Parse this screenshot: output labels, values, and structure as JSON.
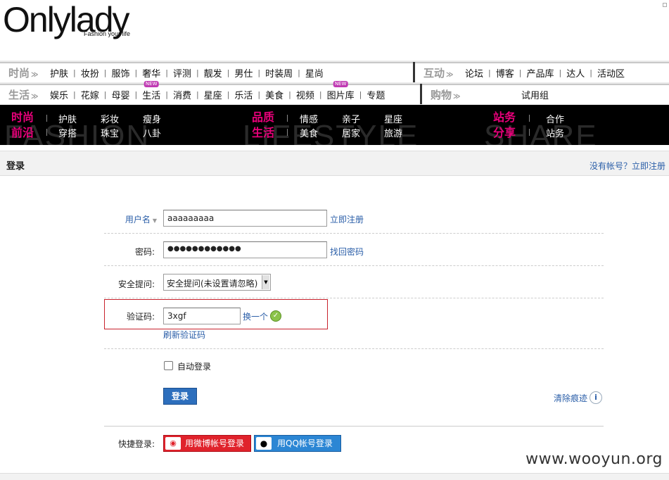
{
  "logo": {
    "brand": "Onlylady",
    "tagline": "Fashion your life"
  },
  "nav": {
    "row1_left_label": "时尚",
    "row1_left_items": [
      "护肤",
      "妆扮",
      "服饰",
      "奢华",
      "评测",
      "靓发",
      "男仕",
      "时装周",
      "星尚"
    ],
    "row1_right_label": "互动",
    "row1_right_items": [
      "论坛",
      "博客",
      "产品库",
      "达人",
      "活动区"
    ],
    "row2_left_label": "生活",
    "row2_left_items": [
      "娱乐",
      "花嫁",
      "母婴",
      "生活",
      "消费",
      "星座",
      "乐活",
      "美食",
      "视频",
      "图片库",
      "专题"
    ],
    "row2_right_label": "购物",
    "row2_right_items": [
      "试用组"
    ],
    "arrow_glyph": "≫",
    "new_badge": "NEW"
  },
  "band": {
    "fashion": {
      "head1": "时尚",
      "head2": "前沿",
      "bg": "FASHION",
      "col1": [
        "护肤",
        "穿搭"
      ],
      "col2": [
        "彩妆",
        "珠宝"
      ],
      "col3": [
        "瘦身",
        "八卦"
      ]
    },
    "life": {
      "head1": "品质",
      "head2": "生活",
      "bg": "LIFESTYLE",
      "col1": [
        "情感",
        "美食"
      ],
      "col2": [
        "亲子",
        "居家"
      ],
      "col3": [
        "星座",
        "旅游"
      ]
    },
    "share": {
      "head1": "站务",
      "head2": "分享",
      "bg": "SHARE",
      "col1": [
        "合作",
        "站务"
      ]
    }
  },
  "titlebar": {
    "title": "登录",
    "register_prompt": "没有帐号？立即注册"
  },
  "form": {
    "username_label": "用户名",
    "username_value": "aaaaaaaaa",
    "register_link": "立即注册",
    "password_label": "密码:",
    "password_value": "●●●●●●●●●●●●",
    "forgot_link": "找回密码",
    "question_label": "安全提问:",
    "question_value": "安全提问(未设置请忽略)",
    "captcha_label": "验证码:",
    "captcha_value": "3xgf",
    "captcha_change": "换一个",
    "captcha_refresh": "刷新验证码",
    "auto_login_label": "自动登录",
    "login_button": "登录",
    "clear_traces": "清除痕迹",
    "quick_login_label": "快捷登录:",
    "weibo_button": "用微博帐号登录",
    "qq_button": "用QQ帐号登录"
  },
  "watermark": "www.wooyun.org"
}
